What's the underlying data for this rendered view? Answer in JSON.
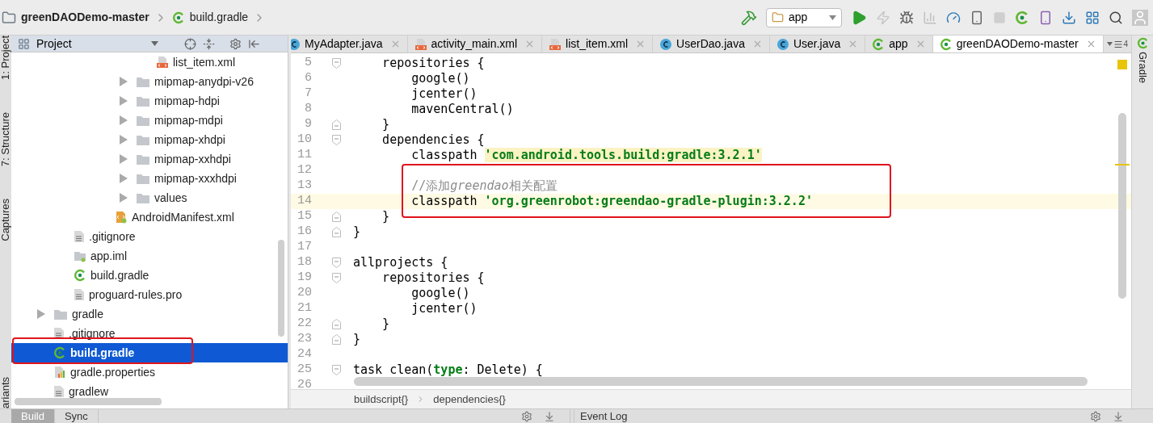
{
  "breadcrumb": [
    {
      "label": "greenDAODemo-master",
      "kind": "folder"
    },
    {
      "label": "build.gradle",
      "kind": "gradle"
    }
  ],
  "run_config": "app",
  "left_strip": [
    "1: Project",
    "7: Structure",
    "Captures",
    "ariants"
  ],
  "right_strip": [
    "Gradle"
  ],
  "project_panel": {
    "title": "Project",
    "tree": [
      {
        "children": [
          {
            "children": [
              {
                "children": [
                  {
                    "children": [
                      {
                        "children": [
                          {
                            "label": "list_item.xml",
                            "kind": "xml",
                            "selected": false
                          }
                        ]
                      },
                      {
                        "label": "mipmap-anydpi-v26",
                        "kind": "folder",
                        "expanded": false,
                        "selected": false
                      },
                      {
                        "label": "mipmap-hdpi",
                        "kind": "folder",
                        "expanded": false,
                        "selected": false
                      },
                      {
                        "label": "mipmap-mdpi",
                        "kind": "folder",
                        "expanded": false,
                        "selected": false
                      },
                      {
                        "label": "mipmap-xhdpi",
                        "kind": "folder",
                        "expanded": false,
                        "selected": false
                      },
                      {
                        "label": "mipmap-xxhdpi",
                        "kind": "folder",
                        "expanded": false,
                        "selected": false
                      },
                      {
                        "label": "mipmap-xxxhdpi",
                        "kind": "folder",
                        "expanded": false,
                        "selected": false
                      },
                      {
                        "label": "values",
                        "kind": "folder",
                        "expanded": false,
                        "selected": false
                      }
                    ]
                  },
                  {
                    "label": "AndroidManifest.xml",
                    "kind": "manifest",
                    "selected": false
                  }
                ]
              }
            ]
          },
          {
            "label": ".gitignore",
            "kind": "text",
            "selected": false
          },
          {
            "label": "app.iml",
            "kind": "iml",
            "selected": false
          },
          {
            "label": "build.gradle",
            "kind": "gradle",
            "selected": false
          },
          {
            "label": "proguard-rules.pro",
            "kind": "text",
            "selected": false
          }
        ]
      },
      {
        "label": "gradle",
        "kind": "folder",
        "expanded": false,
        "selected": false
      },
      {
        "label": ".gitignore",
        "kind": "text",
        "selected": false
      },
      {
        "label": "build.gradle",
        "kind": "gradle",
        "selected": true
      },
      {
        "label": "gradle.properties",
        "kind": "properties",
        "selected": false
      },
      {
        "label": "gradlew",
        "kind": "text",
        "selected": false
      }
    ]
  },
  "editor_tabs": [
    {
      "label": "MyAdapter.java",
      "kind": "java",
      "selected": false
    },
    {
      "label": "activity_main.xml",
      "kind": "xml",
      "selected": false
    },
    {
      "label": "list_item.xml",
      "kind": "xml",
      "selected": false
    },
    {
      "label": "UserDao.java",
      "kind": "java",
      "selected": false
    },
    {
      "label": "User.java",
      "kind": "java",
      "selected": false
    },
    {
      "label": "app",
      "kind": "gradle",
      "selected": false
    },
    {
      "label": "greenDAODemo-master",
      "kind": "gradle",
      "selected": true
    }
  ],
  "tab_overflow_count": "4",
  "code_lines": [
    {
      "number": "5",
      "kind": "fold-start",
      "current": false,
      "segments": [
        {
          "kind": "plain",
          "text": "    repositories {"
        }
      ]
    },
    {
      "number": "6",
      "kind": "plain",
      "current": false,
      "segments": [
        {
          "kind": "plain",
          "text": "        google()"
        }
      ]
    },
    {
      "number": "7",
      "kind": "plain",
      "current": false,
      "segments": [
        {
          "kind": "plain",
          "text": "        jcenter()"
        }
      ]
    },
    {
      "number": "8",
      "kind": "plain",
      "current": false,
      "segments": [
        {
          "kind": "plain",
          "text": "        mavenCentral()"
        }
      ]
    },
    {
      "number": "9",
      "kind": "fold-end",
      "current": false,
      "segments": [
        {
          "kind": "plain",
          "text": "    }"
        }
      ]
    },
    {
      "number": "10",
      "kind": "fold-start",
      "current": false,
      "segments": [
        {
          "kind": "plain",
          "text": "    dependencies {"
        }
      ]
    },
    {
      "number": "11",
      "kind": "plain",
      "current": false,
      "segments": [
        {
          "kind": "plain",
          "text": "        classpath "
        },
        {
          "kind": "string-marked",
          "text": "'com.android.tools.build:gradle:3.2.1'"
        }
      ]
    },
    {
      "number": "12",
      "kind": "plain",
      "current": false
    },
    {
      "number": "13",
      "kind": "plain",
      "current": false,
      "segments": [
        {
          "kind": "comment",
          "text": "        //添加"
        },
        {
          "kind": "comment-italic",
          "text": "greendao"
        },
        {
          "kind": "comment",
          "text": "相关配置"
        }
      ]
    },
    {
      "number": "14",
      "kind": "plain",
      "current": true,
      "segments": [
        {
          "kind": "plain",
          "text": "        classpath "
        },
        {
          "kind": "string",
          "text": "'org.greenrobot:greendao-gradle-plugin:3.2.2'"
        }
      ]
    },
    {
      "number": "15",
      "kind": "fold-end",
      "current": false,
      "segments": [
        {
          "kind": "plain",
          "text": "    }"
        }
      ]
    },
    {
      "number": "16",
      "kind": "fold-end",
      "current": false,
      "segments": [
        {
          "kind": "plain",
          "text": "}"
        }
      ]
    },
    {
      "number": "17",
      "kind": "plain",
      "current": false
    },
    {
      "number": "18",
      "kind": "fold-start",
      "current": false,
      "segments": [
        {
          "kind": "plain",
          "text": "allprojects {"
        }
      ]
    },
    {
      "number": "19",
      "kind": "fold-start",
      "current": false,
      "segments": [
        {
          "kind": "plain",
          "text": "    repositories {"
        }
      ]
    },
    {
      "number": "20",
      "kind": "plain",
      "current": false,
      "segments": [
        {
          "kind": "plain",
          "text": "        google()"
        }
      ]
    },
    {
      "number": "21",
      "kind": "plain",
      "current": false,
      "segments": [
        {
          "kind": "plain",
          "text": "        jcenter()"
        }
      ]
    },
    {
      "number": "22",
      "kind": "fold-end",
      "current": false,
      "segments": [
        {
          "kind": "plain",
          "text": "    }"
        }
      ]
    },
    {
      "number": "23",
      "kind": "fold-end",
      "current": false,
      "segments": [
        {
          "kind": "plain",
          "text": "}"
        }
      ]
    },
    {
      "number": "24",
      "kind": "plain",
      "current": false
    },
    {
      "number": "25",
      "kind": "fold-start",
      "current": false,
      "segments": [
        {
          "kind": "plain",
          "text": "task clean("
        },
        {
          "kind": "keyword",
          "text": "type"
        },
        {
          "kind": "plain",
          "text": ": Delete) {"
        }
      ]
    },
    {
      "number": "26",
      "kind": "plain",
      "current": false
    }
  ],
  "editor_breadcrumb": [
    "buildscript{}",
    "dependencies{}"
  ],
  "bottom_tabs": [
    {
      "label": "Build",
      "selected": true
    },
    {
      "label": "Sync",
      "selected": false
    }
  ],
  "event_log": "Event Log"
}
